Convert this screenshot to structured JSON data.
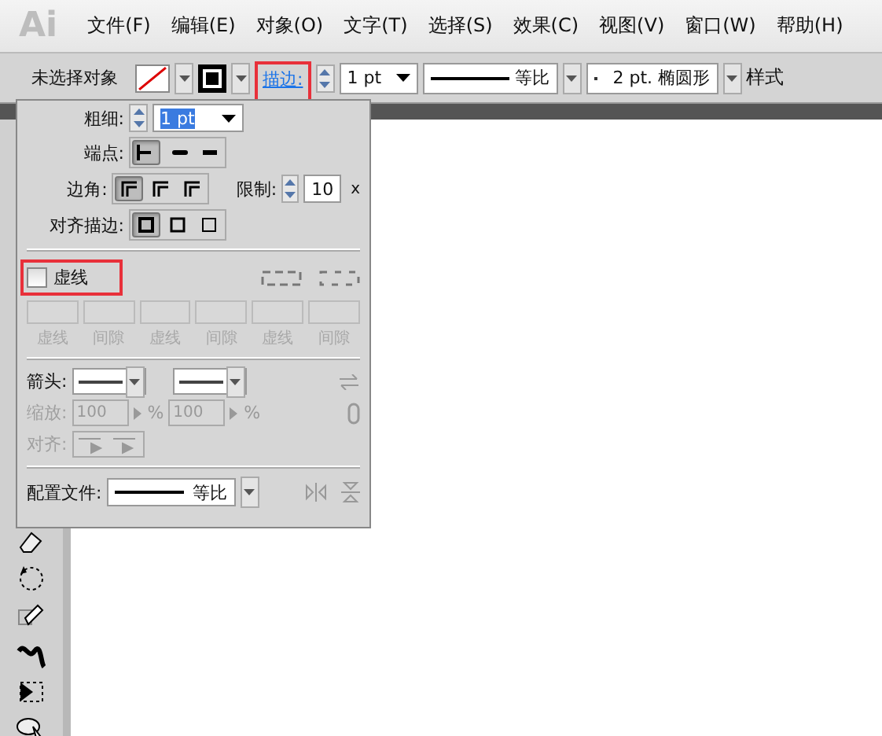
{
  "app_logo": "Ai",
  "menu": [
    "文件(F)",
    "编辑(E)",
    "对象(O)",
    "文字(T)",
    "选择(S)",
    "效果(C)",
    "视图(V)",
    "窗口(W)",
    "帮助(H)"
  ],
  "control_bar": {
    "selection_label": "未选择对象",
    "stroke_link": "描边:",
    "weight": "1 pt",
    "profile": "等比",
    "brush": "2 pt. 椭圆形",
    "style_label": "样式"
  },
  "stroke_panel": {
    "weight_label": "粗细:",
    "weight": "1 pt",
    "cap_label": "端点:",
    "caps": [
      {
        "selected": true
      },
      {
        "selected": false
      },
      {
        "selected": false
      }
    ],
    "corner_label": "边角:",
    "corners": [
      {
        "selected": true
      },
      {
        "selected": false
      },
      {
        "selected": false
      }
    ],
    "limit_label": "限制:",
    "limit": "10",
    "limit_unit": "x",
    "align_label": "对齐描边:",
    "aligns": [
      {
        "selected": true
      },
      {
        "selected": false
      },
      {
        "selected": false
      }
    ],
    "dashed": {
      "label": "虚线",
      "checked": false
    },
    "dash_fields": [
      "虚线",
      "间隙",
      "虚线",
      "间隙",
      "虚线",
      "间隙"
    ],
    "arrow_label": "箭头:",
    "scale_label": "缩放:",
    "scale_start": "100",
    "scale_start_unit": "%",
    "scale_end": "100",
    "scale_end_unit": "%",
    "arrow_align_label": "对齐:",
    "profile_label": "配置文件:",
    "profile": "等比"
  }
}
